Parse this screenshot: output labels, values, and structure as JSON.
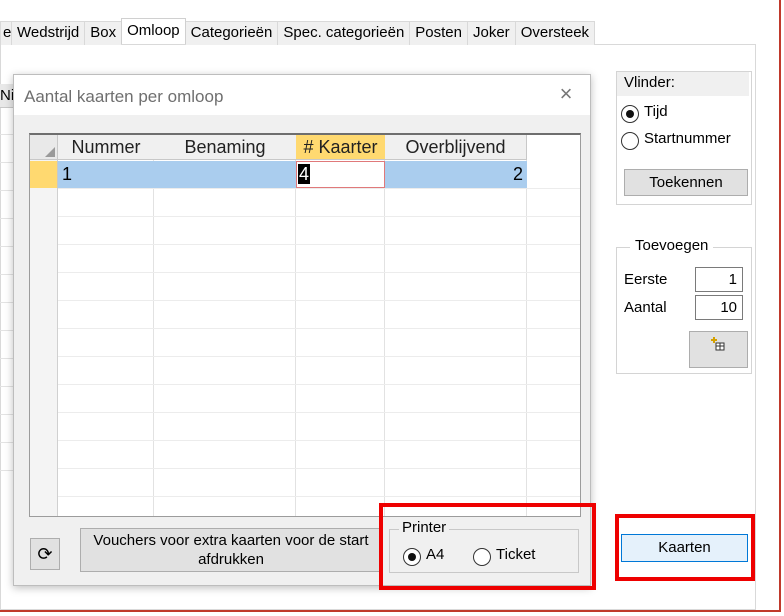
{
  "tabs": [
    {
      "label": "e",
      "active": false
    },
    {
      "label": "Wedstrijd",
      "active": false
    },
    {
      "label": "Box",
      "active": false
    },
    {
      "label": "Omloop",
      "active": true
    },
    {
      "label": "Categorieën",
      "active": false
    },
    {
      "label": "Spec. categorieën",
      "active": false
    },
    {
      "label": "Posten",
      "active": false
    },
    {
      "label": "Joker",
      "active": false
    },
    {
      "label": "Oversteek",
      "active": false
    }
  ],
  "background_grid_header": "Ni",
  "dialog": {
    "title": "Aantal kaarten per omloop",
    "close_icon": "×",
    "grid": {
      "columns": [
        "Nummer",
        "Benaming",
        "# Kaarter",
        "Overblijvend"
      ],
      "rows": [
        {
          "nummer": "1",
          "benaming": "",
          "kaarten": "4",
          "overblijvend": "2"
        }
      ]
    },
    "refresh_icon": "⟳",
    "vouchers_button": "Vouchers voor extra kaarten voor de start afdrukken",
    "printer": {
      "legend": "Printer",
      "options": [
        {
          "label": "A4",
          "selected": true
        },
        {
          "label": "Ticket",
          "selected": false
        }
      ]
    }
  },
  "side": {
    "vlinder": {
      "title": "Vlinder:",
      "options": [
        {
          "label": "Tijd",
          "selected": true
        },
        {
          "label": "Startnummer",
          "selected": false
        }
      ],
      "assign_button": "Toekennen"
    },
    "toevoegen": {
      "title": "Toevoegen",
      "eerste_label": "Eerste",
      "eerste_value": "1",
      "aantal_label": "Aantal",
      "aantal_value": "10"
    },
    "kaarten_button": "Kaarten"
  },
  "colors": {
    "selected_row": "#aacdee",
    "selected_header": "#ffd970",
    "highlight_box": "#ee0000",
    "window_border": "#c0392b"
  }
}
